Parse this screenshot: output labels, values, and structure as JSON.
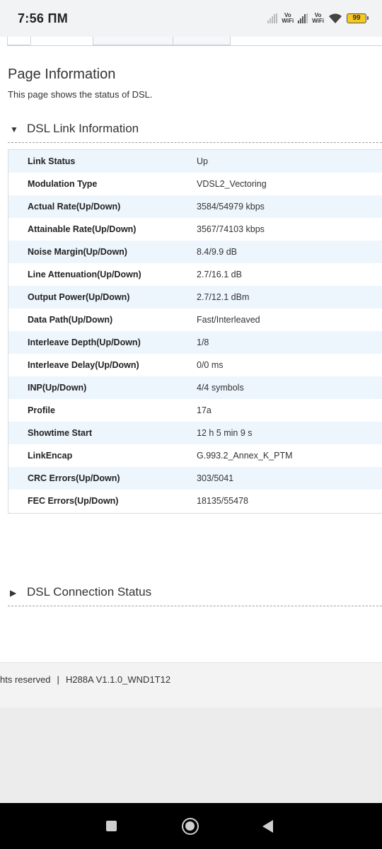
{
  "status_bar": {
    "time": "7:56 ПМ",
    "vo_wifi_label_1": "Vo\nWiFi",
    "vo_wifi_label_2": "Vo\nWiFi",
    "battery": "99"
  },
  "page": {
    "title": "Page Information",
    "description": "This page shows the status of DSL."
  },
  "dsl_link_section": {
    "title": "DSL Link Information",
    "expanded": true,
    "rows": [
      {
        "key": "Link Status",
        "value": "Up"
      },
      {
        "key": "Modulation Type",
        "value": "VDSL2_Vectoring"
      },
      {
        "key": "Actual Rate(Up/Down)",
        "value": "3584/54979 kbps"
      },
      {
        "key": "Attainable Rate(Up/Down)",
        "value": "3567/74103 kbps"
      },
      {
        "key": "Noise Margin(Up/Down)",
        "value": "8.4/9.9 dB"
      },
      {
        "key": "Line Attenuation(Up/Down)",
        "value": "2.7/16.1 dB"
      },
      {
        "key": "Output Power(Up/Down)",
        "value": "2.7/12.1 dBm"
      },
      {
        "key": "Data Path(Up/Down)",
        "value": "Fast/Interleaved"
      },
      {
        "key": "Interleave Depth(Up/Down)",
        "value": "1/8"
      },
      {
        "key": "Interleave Delay(Up/Down)",
        "value": "0/0 ms"
      },
      {
        "key": "INP(Up/Down)",
        "value": "4/4 symbols"
      },
      {
        "key": "Profile",
        "value": "17a"
      },
      {
        "key": "Showtime Start",
        "value": "12 h 5 min 9 s"
      },
      {
        "key": "LinkEncap",
        "value": "G.993.2_Annex_K_PTM"
      },
      {
        "key": "CRC Errors(Up/Down)",
        "value": "303/5041"
      },
      {
        "key": "FEC Errors(Up/Down)",
        "value": "18135/55478"
      }
    ]
  },
  "dsl_connection_section": {
    "title": "DSL Connection Status",
    "expanded": false
  },
  "footer": {
    "copyright_fragment": "hts reserved",
    "separator": "|",
    "firmware": "H288A V1.1.0_WND1T12"
  },
  "icons": {
    "expanded_arrow": "triangle-down",
    "collapsed_arrow": "triangle-right"
  },
  "colors": {
    "row_stripe": "#eef6fd",
    "footer_bg": "#f3f3f3",
    "nav_bg": "#000000"
  }
}
